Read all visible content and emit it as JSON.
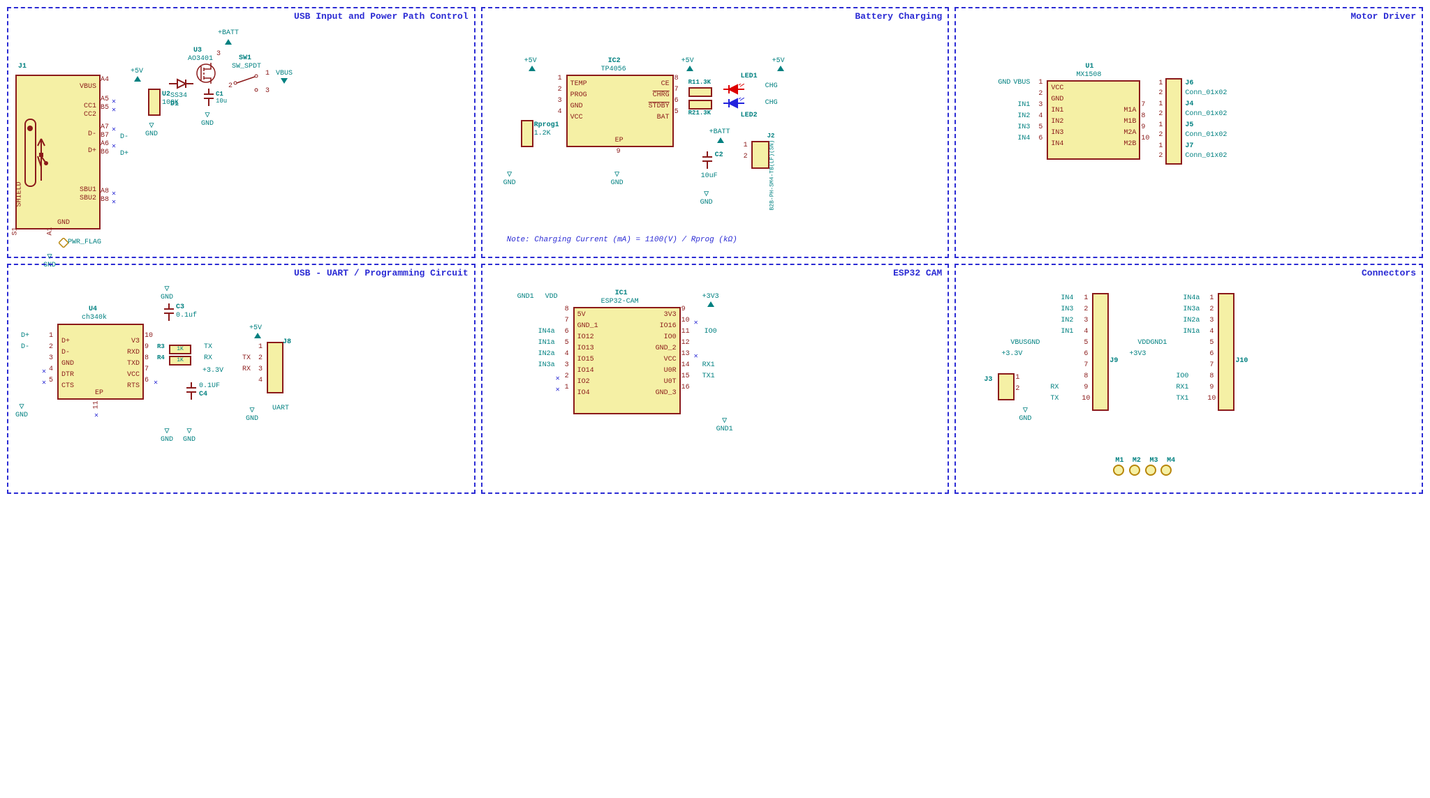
{
  "blocks": {
    "usb_input": {
      "title": "USB Input and Power Path Control",
      "J1": {
        "ref": "J1",
        "pins": {
          "vbus": "VBUS",
          "cc1": "CC1",
          "cc2": "CC2",
          "dminus": "D-",
          "dplus": "D+",
          "sbu1": "SBU1",
          "sbu2": "SBU2",
          "shield": "SHIELD",
          "gnd": "GND"
        },
        "pnum": {
          "a4": "A4",
          "a5": "A5",
          "b5": "B5",
          "a7": "A7",
          "b7": "B7",
          "a6": "A6",
          "b6": "B6",
          "a8": "A8",
          "b8": "B8",
          "s1": "S1",
          "a1": "A1"
        }
      },
      "U2": {
        "ref": "U2",
        "value": "100K"
      },
      "U3": {
        "ref": "U3",
        "value": "AO3401",
        "pin3": "3"
      },
      "D1": {
        "ref": "D1",
        "value": "SS34"
      },
      "C1": {
        "ref": "C1",
        "value": "10u"
      },
      "SW1": {
        "ref": "SW1",
        "value": "SW_SPDT",
        "p1": "1",
        "p2": "2",
        "p3": "3"
      },
      "nets": {
        "plus5v": "+5V",
        "vbus": "VBUS",
        "batt": "+BATT",
        "gnd": "GND",
        "dminus": "D-",
        "dplus": "D+"
      },
      "pwr_flag": "PWR_FLAG"
    },
    "battery": {
      "title": "Battery Charging",
      "IC2": {
        "ref": "IC2",
        "value": "TP4056",
        "pins_l": {
          "temp": "TEMP",
          "prog": "PROG",
          "gnd": "GND",
          "vcc": "VCC"
        },
        "pins_r": {
          "ce": "CE",
          "chrg": "CHRG",
          "stdby": "STDBY",
          "bat": "BAT"
        },
        "pnum_l": {
          "1": "1",
          "2": "2",
          "3": "3",
          "4": "4"
        },
        "pnum_r": {
          "8": "8",
          "7": "7",
          "6": "6",
          "5": "5"
        },
        "ep": "EP",
        "ep_num": "9"
      },
      "Rprog1": {
        "ref": "Rprog1",
        "value": "1.2K"
      },
      "R1": {
        "ref": "R1",
        "value": "1.3K"
      },
      "R2": {
        "ref": "R2",
        "value": "1.3K"
      },
      "LED1": {
        "ref": "LED1"
      },
      "LED2": {
        "ref": "LED2"
      },
      "C2": {
        "ref": "C2",
        "value": "10uF"
      },
      "J2": {
        "ref": "J2",
        "value": "B2B-PH-SM4-TB(LF)(SN)",
        "p1": "1",
        "p2": "2"
      },
      "nets": {
        "plus5v": "+5V",
        "gnd": "GND",
        "batt": "+BATT",
        "chg": "CHG"
      },
      "note": "Note: Charging Current (mA) = 1100(V) / Rprog (kΩ)"
    },
    "motor": {
      "title": "Motor Driver",
      "U1": {
        "ref": "U1",
        "value": "MX1508",
        "pins_l": {
          "vcc": "VCC",
          "gnd": "GND",
          "in1": "IN1",
          "in2": "IN2",
          "in3": "IN3",
          "in4": "IN4"
        },
        "pins_r": {
          "m1a": "M1A",
          "m1b": "M1B",
          "m2a": "M2A",
          "m2b": "M2B"
        },
        "pnum_l": {
          "1": "1",
          "2": "2",
          "3": "3",
          "4": "4",
          "5": "5",
          "6": "6"
        },
        "pnum_r": {
          "7": "7",
          "8": "8",
          "9": "9",
          "10": "10"
        }
      },
      "J6": {
        "ref": "J6",
        "value": "Conn_01x02",
        "p1": "1",
        "p2": "2"
      },
      "J4": {
        "ref": "J4",
        "value": "Conn_01x02",
        "p1": "1",
        "p2": "2"
      },
      "J5": {
        "ref": "J5",
        "value": "Conn_01x02",
        "p1": "1",
        "p2": "2"
      },
      "J7": {
        "ref": "J7",
        "value": "Conn_01x02",
        "p1": "1",
        "p2": "2"
      },
      "nets": {
        "gnd": "GND",
        "vbus": "VBUS",
        "in1": "IN1",
        "in2": "IN2",
        "in3": "IN3",
        "in4": "IN4"
      }
    },
    "usb_uart": {
      "title": "USB - UART / Programming Circuit",
      "U4": {
        "ref": "U4",
        "value": "ch340k",
        "pins_l": {
          "dplus": "D+",
          "dminus": "D-",
          "gnd": "GND",
          "dtr": "DTR",
          "cts": "CTS"
        },
        "pins_r": {
          "v3": "V3",
          "rxd": "RXD",
          "txd": "TXD",
          "vcc": "VCC",
          "rts": "RTS"
        },
        "pnum_l": {
          "1": "1",
          "2": "2",
          "3": "3",
          "4": "4",
          "5": "5"
        },
        "pnum_r": {
          "10": "10",
          "9": "9",
          "8": "8",
          "7": "7",
          "6": "6"
        },
        "ep": "EP",
        "ep_num": "11"
      },
      "R3": {
        "ref": "R3",
        "value": "1K"
      },
      "R4": {
        "ref": "R4",
        "value": "1K"
      },
      "C3": {
        "ref": "C3",
        "value": "0.1uf"
      },
      "C4": {
        "ref": "C4",
        "value": "0.1UF"
      },
      "J8": {
        "ref": "J8",
        "value": "UART",
        "pins": {
          "tx": "TX",
          "rx": "RX",
          "p5v": "+5V"
        },
        "pnum": {
          "1": "1",
          "2": "2",
          "3": "3",
          "4": "4"
        }
      },
      "nets": {
        "dplus": "D+",
        "dminus": "D-",
        "gnd": "GND",
        "plus5v": "+5V",
        "p3v3": "+3.3V",
        "tx": "TX",
        "rx": "RX"
      }
    },
    "esp32": {
      "title": "ESP32 CAM",
      "IC1": {
        "ref": "IC1",
        "value": "ESP32-CAM",
        "pins_l": {
          "5v": "5V",
          "gnd1": "GND_1",
          "io12": "IO12",
          "io13": "IO13",
          "io15": "IO15",
          "io14": "IO14",
          "io2": "IO2",
          "io4": "IO4"
        },
        "pins_r": {
          "3v3": "3V3",
          "io16": "IO16",
          "io0": "IO0",
          "gnd2": "GND_2",
          "vcc": "VCC",
          "u0r": "U0R",
          "u0t": "U0T",
          "gnd3": "GND_3"
        },
        "pnum_l": {
          "8": "8",
          "7": "7",
          "6": "6",
          "5": "5",
          "4": "4",
          "3": "3",
          "2": "2",
          "1": "1"
        },
        "pnum_r": {
          "9": "9",
          "10": "10",
          "11": "11",
          "12": "12",
          "13": "13",
          "14": "14",
          "15": "15",
          "16": "16"
        }
      },
      "nets": {
        "gnd1": "GND1",
        "vdd": "VDD",
        "p3v3": "+3V3",
        "in4a": "IN4a",
        "in1a": "IN1a",
        "in2a": "IN2a",
        "in3a": "IN3a",
        "io0": "IO0",
        "rx1": "RX1",
        "tx1": "TX1"
      }
    },
    "connectors": {
      "title": "Connectors",
      "J9": {
        "ref": "J9",
        "pnum": {
          "1": "1",
          "2": "2",
          "3": "3",
          "4": "4",
          "5": "5",
          "6": "6",
          "7": "7",
          "8": "8",
          "9": "9",
          "10": "10"
        }
      },
      "J10": {
        "ref": "J10",
        "pnum": {
          "1": "1",
          "2": "2",
          "3": "3",
          "4": "4",
          "5": "5",
          "6": "6",
          "7": "7",
          "8": "8",
          "9": "9",
          "10": "10"
        }
      },
      "J3": {
        "ref": "J3",
        "p1": "1",
        "p2": "2"
      },
      "nets": {
        "in4": "IN4",
        "in3": "IN3",
        "in2": "IN2",
        "in1": "IN1",
        "vbus": "VBUS",
        "gnd": "GND",
        "p3v3": "+3.3V",
        "rx": "RX",
        "tx": "TX",
        "in4a": "IN4a",
        "in3a": "IN3a",
        "in2a": "IN2a",
        "in1a": "IN1a",
        "vdd": "VDD",
        "gnd1": "GND1",
        "p3v3b": "+3V3",
        "io0": "IO0",
        "rx1": "RX1",
        "tx1": "TX1"
      },
      "mounts": {
        "m1": "M1",
        "m2": "M2",
        "m3": "M3",
        "m4": "M4"
      }
    }
  }
}
